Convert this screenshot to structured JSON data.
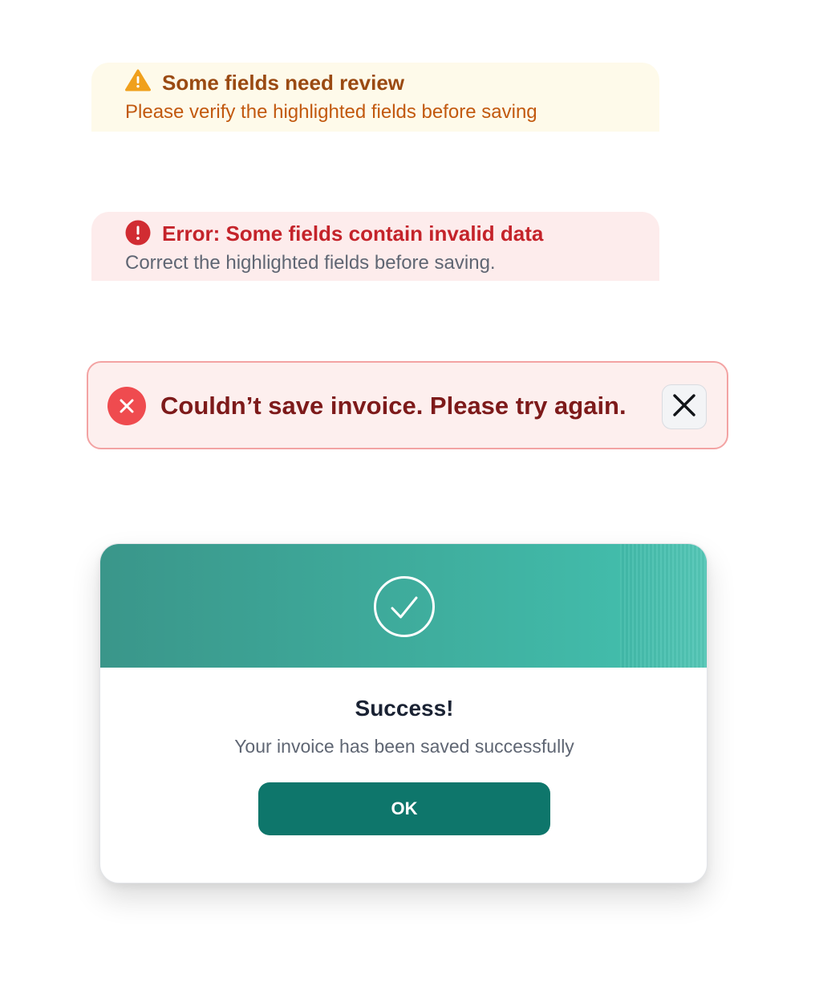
{
  "warning_banner": {
    "icon": "warning-triangle-icon",
    "title": "Some fields need review",
    "message": "Please verify the highlighted fields before saving",
    "colors": {
      "background": "#fefaea",
      "title": "#9a4a12",
      "message": "#c2590f",
      "icon": "#f0a01c"
    }
  },
  "error_banner": {
    "icon": "error-circle-icon",
    "title": "Error: Some fields contain invalid data",
    "message": "Correct the highlighted fields before saving.",
    "colors": {
      "background": "#fdecec",
      "title": "#c4232a",
      "message": "#5f6673",
      "icon": "#d12c32"
    }
  },
  "toast": {
    "icon": "error-x-circle-icon",
    "message": "Couldn’t save invoice. Please try again.",
    "close_icon": "close-icon",
    "colors": {
      "background": "#fdefee",
      "border": "#f3a3a3",
      "text": "#7d1a1a",
      "icon": "#ef4b4f"
    }
  },
  "success_modal": {
    "header_icon": "check-circle-icon",
    "title": "Success!",
    "message": "Your invoice has been saved successfully",
    "ok_label": "OK",
    "colors": {
      "header_start": "#3a968a",
      "header_end": "#43c2b0",
      "button": "#0e766b",
      "title": "#1a2233"
    }
  }
}
